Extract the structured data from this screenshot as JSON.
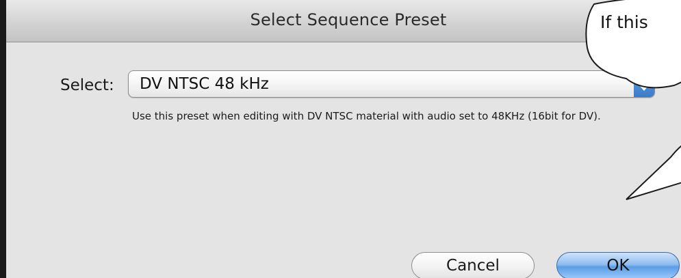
{
  "window": {
    "title": "Select Sequence Preset"
  },
  "preset": {
    "label": "Select:",
    "selected_value": "DV NTSC 48 kHz",
    "description": "Use this preset when editing with DV NTSC material with audio set to 48KHz (16bit for DV)."
  },
  "buttons": {
    "cancel_label": "Cancel",
    "ok_label": "OK"
  },
  "callout": {
    "text": "If this"
  },
  "colors": {
    "dialog_background": "#e4e4e4",
    "default_button": "#5a9de6",
    "popup_arrows": "#4f8fd6"
  }
}
